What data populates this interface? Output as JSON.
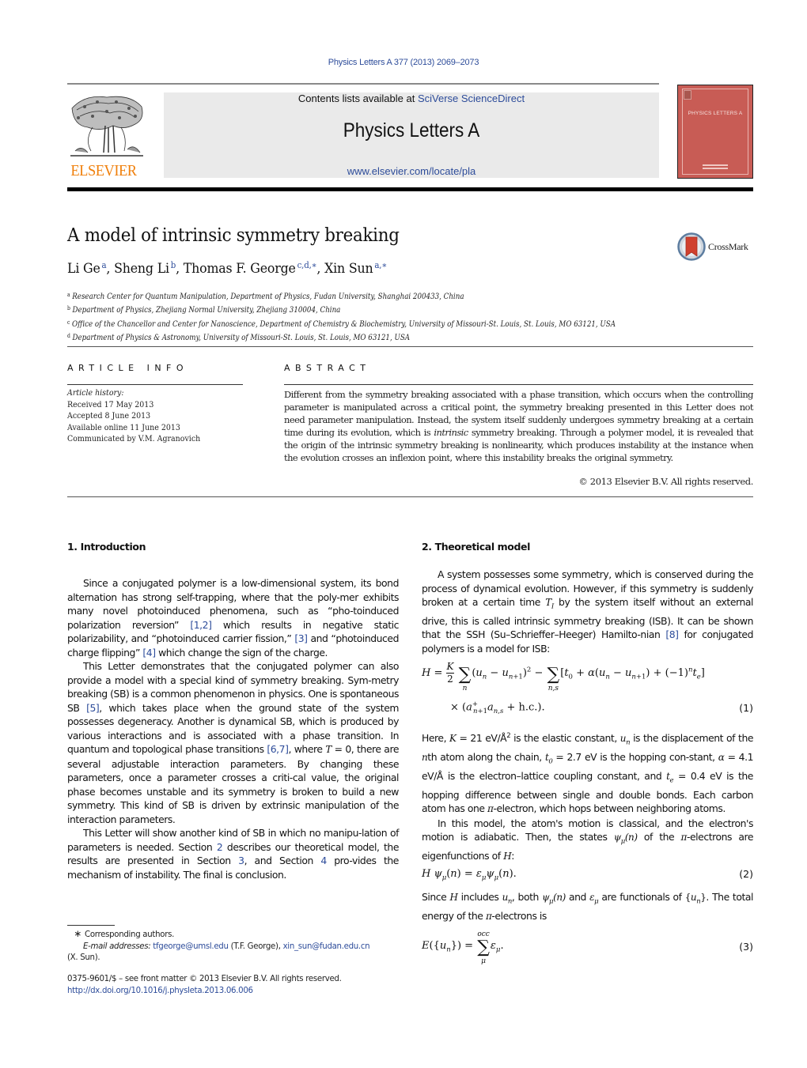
{
  "header": {
    "citation": "Physics Letters A 377 (2013) 2069–2073",
    "contents_prefix": "Contents lists available at ",
    "contents_link": "SciVerse ScienceDirect",
    "journal_name": "Physics Letters A",
    "journal_url": "www.elsevier.com/locate/pla",
    "publisher_logo_text": "ELSEVIER",
    "cover_title": "PHYSICS LETTERS A",
    "crossmark_label": "CrossMark",
    "colors": {
      "link": "#2d4c9a",
      "elsevier_orange": "#f07f0a",
      "cover": "#c85c55",
      "masthead_bg": "#eaeaea"
    }
  },
  "article": {
    "title": "A model of intrinsic symmetry breaking",
    "authors": [
      {
        "name": "Li Ge",
        "marks": "a"
      },
      {
        "name": "Sheng Li",
        "marks": "b"
      },
      {
        "name": "Thomas F. George",
        "marks": "c,d,∗"
      },
      {
        "name": "Xin Sun",
        "marks": "a,∗"
      }
    ],
    "affiliations": [
      {
        "mark": "a",
        "text": "Research Center for Quantum Manipulation, Department of Physics, Fudan University, Shanghai 200433, China"
      },
      {
        "mark": "b",
        "text": "Department of Physics, Zhejiang Normal University, Zhejiang 310004, China"
      },
      {
        "mark": "c",
        "text": "Office of the Chancellor and Center for Nanoscience, Department of Chemistry & Biochemistry, University of Missouri-St. Louis, St. Louis, MO 63121, USA"
      },
      {
        "mark": "d",
        "text": "Department of Physics & Astronomy, University of Missouri-St. Louis, St. Louis, MO 63121, USA"
      }
    ]
  },
  "article_info": {
    "heading": "ARTICLE INFO",
    "history_label": "Article history:",
    "received": "Received 17 May 2013",
    "accepted": "Accepted 8 June 2013",
    "online": "Available online 11 June 2013",
    "communicated": "Communicated by V.M. Agranovich"
  },
  "abstract": {
    "heading": "ABSTRACT",
    "text_before_italic": "Different from the symmetry breaking associated with a phase transition, which occurs when the controlling parameter is manipulated across a critical point, the symmetry breaking presented in this Letter does not need parameter manipulation. Instead, the system itself suddenly undergoes symmetry breaking at a certain time during its evolution, which is ",
    "italic": "intrinsic",
    "text_after_italic": " symmetry breaking. Through a polymer model, it is revealed that the origin of the intrinsic symmetry breaking is nonlinearity, which produces instability at the instance when the evolution crosses an inflexion point, where this instability breaks the original symmetry.",
    "copyright": "© 2013 Elsevier B.V. All rights reserved."
  },
  "intro": {
    "heading": "1. Introduction",
    "p1": [
      "Since a conjugated polymer is a low-dimensional system, its bond alternation has strong self-trapping, where that the poly-mer exhibits many novel photoinduced phenomena, such as “pho-toinduced polarization reversion” ",
      "[1,2]",
      " which results in negative static polarizability, and “photoinduced carrier fission,” ",
      "[3]",
      " and “photoinduced charge flipping” ",
      "[4]",
      " which change the sign of the charge."
    ],
    "p2": [
      "This Letter demonstrates that the conjugated polymer can also provide a model with a special kind of symmetry breaking. Sym-metry breaking (SB) is a common phenomenon in physics. One is spontaneous SB ",
      "[5]",
      ", which takes place when the ground state of the system possesses degeneracy. Another is dynamical SB, which is produced by various interactions and is associated with a phase transition. In quantum and topological phase transitions ",
      "[6,7]",
      ", where ",
      "T",
      " = 0, there are several adjustable interaction parameters. By changing these parameters, once a parameter crosses a criti-cal value, the original phase becomes unstable and its symmetry is broken to build a new symmetry. This kind of SB is driven by extrinsic manipulation of the interaction parameters."
    ],
    "p3": [
      "This Letter will show another kind of SB in which no manipu-lation of parameters is needed. Section ",
      "2",
      " describes our theoretical model, the results are presented in Section ",
      "3",
      ", and Section ",
      "4",
      " pro-vides the mechanism of instability. The final is conclusion."
    ]
  },
  "model": {
    "heading": "2. Theoretical model",
    "p1": [
      "A system possesses some symmetry, which is conserved during the process of dynamical evolution. However, if this symmetry is suddenly broken at a certain time ",
      " by the system itself without an external drive, this is called intrinsic symmetry breaking (ISB). It can be shown that the SSH (Su–Schrieffer–Heeger) Hamilto-nian ",
      "[8]",
      " for conjugated polymers is a model for ISB:"
    ],
    "eq1_number": "(1)",
    "p2": [
      "Here, ",
      " = 21 eV/Å",
      " is the elastic constant, ",
      " is the displacement of the ",
      "th atom along the chain, ",
      " = 2.7 eV is the hopping con-stant, ",
      " = 4.1 eV/Å is the electron–lattice coupling constant, and ",
      " = 0.4 eV is the hopping difference between single and double bonds. Each carbon atom has one ",
      "-electron, which hops between neighboring atoms."
    ],
    "p3": [
      "In this model, the atom's motion is classical, and the electron's motion is adiabatic. Then, the states ",
      " of the ",
      "-electrons are eigenfunctions of ",
      ":"
    ],
    "eq2_number": "(2)",
    "p4": [
      "Since ",
      " includes ",
      ", both ",
      " and ",
      " are functionals of ",
      ". The total energy of the ",
      "-electrons is"
    ],
    "eq3_number": "(3)"
  },
  "footnotes": {
    "star": "∗",
    "corresponding": "Corresponding authors.",
    "email_label": "E-mail addresses:",
    "email1": "tfgeorge@umsl.edu",
    "email1_owner": " (T.F. George), ",
    "email2": "xin_sun@fudan.edu.cn",
    "email2_owner": "(X. Sun).",
    "front_matter": "0375-9601/$ – see front matter  © 2013 Elsevier B.V. All rights reserved.",
    "doi": "http://dx.doi.org/10.1016/j.physleta.2013.06.006"
  }
}
